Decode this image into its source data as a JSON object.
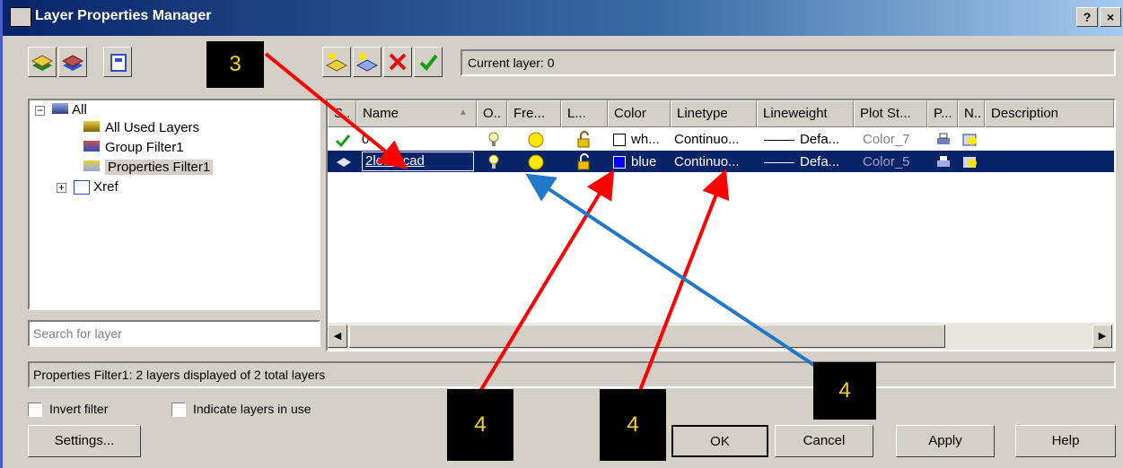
{
  "window": {
    "title": "Layer Properties Manager",
    "help_label": "?",
    "close_label": "×"
  },
  "toolbar": {
    "current_layer": "Current layer: 0"
  },
  "tree": {
    "items": [
      "All",
      "All Used Layers",
      "Group Filter1",
      "Properties Filter1",
      "Xref"
    ],
    "expand_all": "−",
    "expand_xref": "+"
  },
  "search": {
    "placeholder": "Search for layer"
  },
  "grid": {
    "columns": [
      "S..",
      "Name",
      "O..",
      "Fre...",
      "L...",
      "Color",
      "Linetype",
      "Lineweight",
      "Plot St...",
      "P...",
      "N..",
      "Description"
    ],
    "rows": [
      {
        "name": "0",
        "color": "wh...",
        "linetype": "Continuo...",
        "lineweight": "Defa...",
        "plotstyle": "Color_7",
        "color_hex": "#ffffff"
      },
      {
        "name": "2learncad",
        "color": "blue",
        "linetype": "Continuo...",
        "lineweight": "Defa...",
        "plotstyle": "Color_5",
        "color_hex": "#0000ff"
      }
    ]
  },
  "status": {
    "text": "Properties Filter1: 2 layers displayed of 2 total layers"
  },
  "options": {
    "invert": "Invert filter",
    "indicate": "Indicate layers in use"
  },
  "buttons": {
    "settings": "Settings...",
    "ok": "OK",
    "cancel": "Cancel",
    "apply": "Apply",
    "help": "Help"
  },
  "callouts": [
    "3",
    "4",
    "4",
    "4"
  ],
  "colors": {
    "annotation_red": "#ff0000",
    "annotation_blue": "#1f78c8",
    "callout_text": "#ffd700",
    "selection": "#0a246a"
  }
}
